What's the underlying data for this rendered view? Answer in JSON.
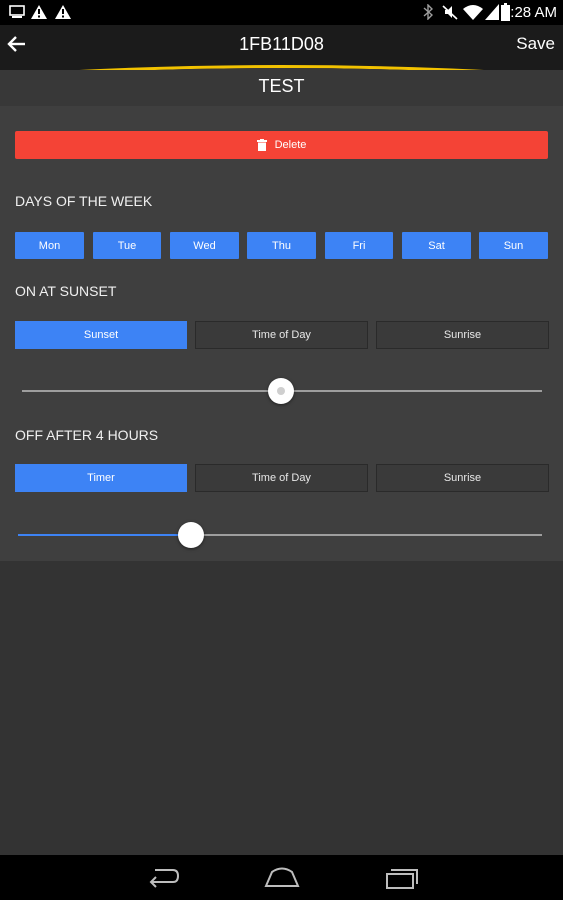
{
  "status_bar": {
    "time": "8:28 AM",
    "left_icons": [
      "screen-icon",
      "warning-icon",
      "warning-icon"
    ],
    "right_icons": [
      "bluetooth-icon",
      "mute-icon",
      "wifi-icon",
      "signal-icon",
      "battery-icon"
    ]
  },
  "action_bar": {
    "title": "1FB11D08",
    "save_label": "Save",
    "back_icon": "back-arrow-icon",
    "accent_color": "#f2c200"
  },
  "subheader": {
    "title": "TEST"
  },
  "delete": {
    "label": "Delete",
    "icon": "trash-icon",
    "color": "#f44336"
  },
  "days": {
    "label": "DAYS OF THE WEEK",
    "items": [
      "Mon",
      "Tue",
      "Wed",
      "Thu",
      "Fri",
      "Sat",
      "Sun"
    ],
    "selected": [
      true,
      true,
      true,
      true,
      true,
      true,
      true
    ]
  },
  "on_section": {
    "label": "ON AT SUNSET",
    "options": [
      "Sunset",
      "Time of Day",
      "Sunrise"
    ],
    "selected": "Sunset",
    "slider_value": 0.5
  },
  "off_section": {
    "label": "OFF AFTER 4 HOURS",
    "options": [
      "Timer",
      "Time of Day",
      "Sunrise"
    ],
    "selected": "Timer",
    "slider_value": 0.33
  },
  "nav_bar": {
    "icons": [
      "nav-back-icon",
      "nav-home-icon",
      "nav-recents-icon"
    ]
  },
  "colors": {
    "primary": "#3d83f5",
    "danger": "#f44336",
    "background": "#333333",
    "panel": "#3f3f3f"
  }
}
